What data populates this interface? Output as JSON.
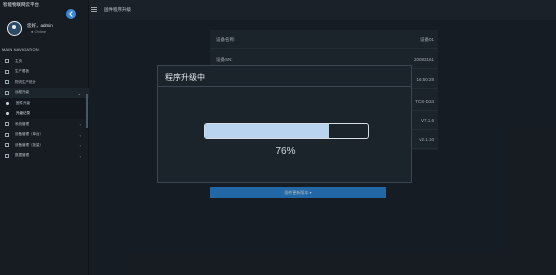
{
  "app": {
    "brand": "智能物联网云平台"
  },
  "user": {
    "name": "您好，admin",
    "status": "● Online"
  },
  "nav": {
    "heading": "MAIN NAVIGATION",
    "items": [
      {
        "label": "主页",
        "icon": "home-icon",
        "type": "item"
      },
      {
        "label": "生产看板",
        "icon": "dashboard-icon",
        "type": "item"
      },
      {
        "label": "物流生产统计",
        "icon": "calendar-icon",
        "type": "item"
      },
      {
        "label": "远程升级",
        "icon": "cloud-icon",
        "type": "group-open"
      },
      {
        "label": "固件升级",
        "icon": "dot-icon",
        "type": "sub"
      },
      {
        "label": "升级记录",
        "icon": "dot-icon",
        "type": "sub-active"
      },
      {
        "label": "系统管理",
        "icon": "gear-icon",
        "type": "group"
      },
      {
        "label": "设备管理（单台）",
        "icon": "device-icon",
        "type": "group"
      },
      {
        "label": "设备管理（批量）",
        "icon": "devices-icon",
        "type": "group"
      },
      {
        "label": "数据管理",
        "icon": "database-icon",
        "type": "group"
      }
    ]
  },
  "header": {
    "title": "固件程序升级"
  },
  "detail": {
    "rows": [
      {
        "k": "设备名称:",
        "v": "设备01"
      },
      {
        "k": "设备SN:",
        "v": "20083161"
      },
      {
        "k": "",
        "v": "16:50:28"
      },
      {
        "k": "",
        "v": "TCS-D34"
      },
      {
        "k": "",
        "v": "V7.1.6"
      },
      {
        "k": "",
        "v": "v2.1.10"
      }
    ],
    "upgrade_button": "固件更新版本 ▾"
  },
  "modal": {
    "title": "程序升级中",
    "progress": 0.76,
    "progress_text": "76%"
  },
  "colors": {
    "accent": "#2a86d8",
    "progress_fill": "#b9d4ef",
    "background": "#1a2128"
  }
}
